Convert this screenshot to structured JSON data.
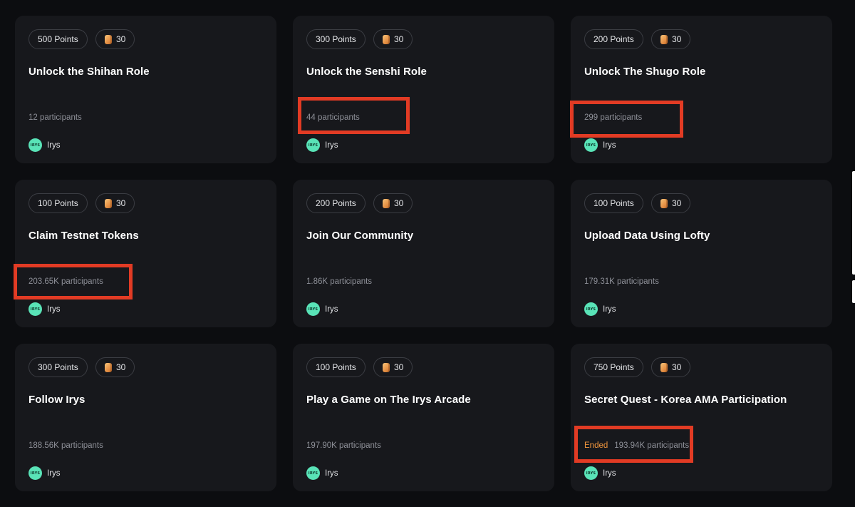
{
  "quests": [
    {
      "points": "500 Points",
      "reward": "30",
      "title": "Unlock the Shihan Role",
      "participants": "12 participants",
      "status": "",
      "org": "Irys"
    },
    {
      "points": "300 Points",
      "reward": "30",
      "title": "Unlock the Senshi Role",
      "participants": "44 participants",
      "status": "",
      "org": "Irys"
    },
    {
      "points": "200 Points",
      "reward": "30",
      "title": "Unlock The Shugo Role",
      "participants": "299 participants",
      "status": "",
      "org": "Irys"
    },
    {
      "points": "100 Points",
      "reward": "30",
      "title": "Claim Testnet Tokens",
      "participants": "203.65K participants",
      "status": "",
      "org": "Irys"
    },
    {
      "points": "200 Points",
      "reward": "30",
      "title": "Join Our Community",
      "participants": "1.86K participants",
      "status": "",
      "org": "Irys"
    },
    {
      "points": "100 Points",
      "reward": "30",
      "title": "Upload Data Using Lofty",
      "participants": "179.31K participants",
      "status": "",
      "org": "Irys"
    },
    {
      "points": "300 Points",
      "reward": "30",
      "title": "Follow Irys",
      "participants": "188.56K participants",
      "status": "",
      "org": "Irys"
    },
    {
      "points": "100 Points",
      "reward": "30",
      "title": "Play a Game on The Irys Arcade",
      "participants": "197.90K participants",
      "status": "",
      "org": "Irys"
    },
    {
      "points": "750 Points",
      "reward": "30",
      "title": "Secret Quest - Korea AMA Participation",
      "participants": "193.94K participants",
      "status": "Ended",
      "org": "Irys"
    }
  ],
  "org_logo_text": "IRYS",
  "colors": {
    "background": "#0c0d10",
    "card": "#17181c",
    "highlight": "#e23b24",
    "ended": "#f0953c",
    "org_logo": "#59e3b7"
  },
  "icons": {
    "reward": "reward-token-icon",
    "org": "irys-logo-icon"
  }
}
